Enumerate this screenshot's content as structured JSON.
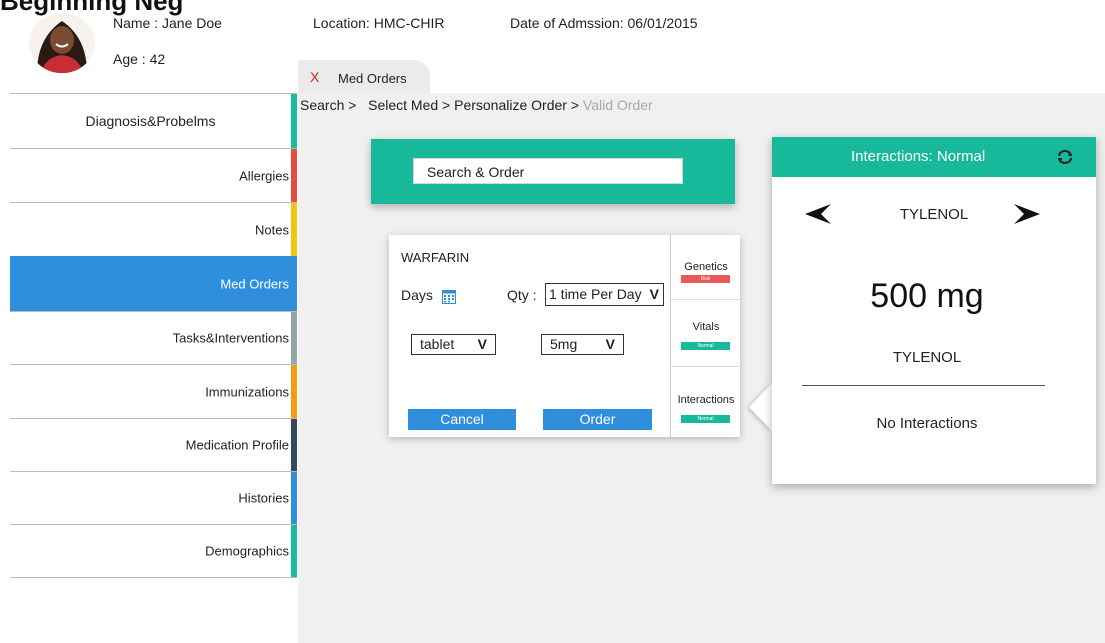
{
  "header": {
    "page_title": "Beginning Neg",
    "patient_name": "Name : Jane Doe",
    "patient_age": "Age : 42",
    "location": "Location: HMC-CHIR",
    "admission": "Date of Admssion: 06/01/2015"
  },
  "tab": {
    "close_label": "X",
    "label": "Med Orders"
  },
  "breadcrumb": {
    "search": "Search >",
    "select_med": "Select Med >",
    "personalize": "Personalize Order >",
    "valid": "Valid Order"
  },
  "sidebar": {
    "items": [
      {
        "label": "Diagnosis&Probelms",
        "color": "#1abc9c"
      },
      {
        "label": "Allergies",
        "color": "#e74c3c"
      },
      {
        "label": "Notes",
        "color": "#f1c40f"
      },
      {
        "label": "Med Orders",
        "color": "#2f8fdc"
      },
      {
        "label": "Tasks&Interventions",
        "color": "#95a5a6"
      },
      {
        "label": "Immunizations",
        "color": "#f39c12"
      },
      {
        "label": "Medication Profile",
        "color": "#34495e"
      },
      {
        "label": "Histories",
        "color": "#2f8fdc"
      },
      {
        "label": "Demographics",
        "color": "#1abc9c"
      }
    ]
  },
  "search": {
    "value": "Search & Order"
  },
  "order": {
    "drug": "WARFARIN",
    "days_label": "Days",
    "qty_label": "Qty :",
    "qty_value": "1 time Per Day",
    "form_value": "tablet",
    "dose_value": "5mg",
    "cancel_label": "Cancel",
    "order_label": "Order",
    "dropdown_arrow": "V"
  },
  "status_checks": [
    {
      "label": "Genetics",
      "badge": "Risk",
      "color": "#e85a5a"
    },
    {
      "label": "Vitals",
      "badge": "Normal",
      "color": "#18b99a"
    },
    {
      "label": "Interactions",
      "badge": "Normal",
      "color": "#18b99a"
    }
  ],
  "interactions": {
    "title": "Interactions: Normal",
    "drug_top": "TYLENOL",
    "dose": "500 mg",
    "drug_bottom": "TYLENOL",
    "result": "No Interactions"
  },
  "colors": {
    "accent_teal": "#18b99a",
    "accent_blue": "#2f8fdc",
    "content_bg": "#f0f0f0"
  }
}
